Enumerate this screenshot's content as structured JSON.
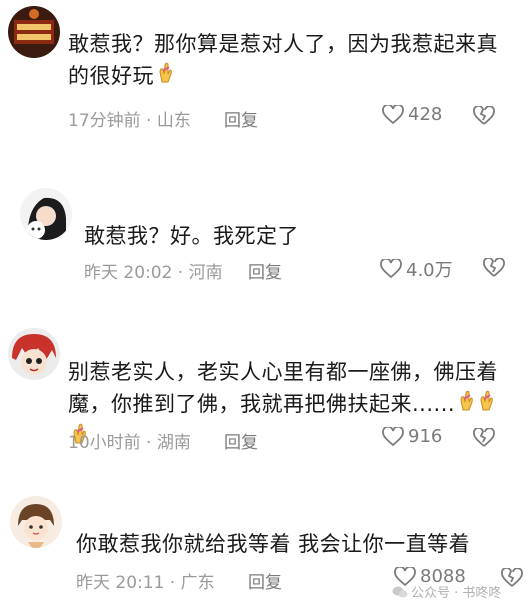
{
  "comments": [
    {
      "avatar": "avatar-sign-red",
      "text": "敢惹我？那你算是惹对人了，因为我惹起来真的很好玩",
      "emoji": "crossed-fingers-icon",
      "time": "17分钟前",
      "location": "山东",
      "reply_label": "回复",
      "likes": "428"
    },
    {
      "avatar": "avatar-girl-cat",
      "text": "敢惹我？好。我死定了",
      "emoji": "",
      "time": "昨天 20:02",
      "location": "河南",
      "reply_label": "回复",
      "likes": "4.0万"
    },
    {
      "avatar": "avatar-anime-redhair",
      "text": "别惹老实人，老实人心里有都一座佛，佛压着魔，你推到了佛，我就再把佛扶起来......",
      "emoji": "crossed-fingers-icon x3",
      "time": "10小时前",
      "location": "湖南",
      "reply_label": "回复",
      "likes": "916"
    },
    {
      "avatar": "avatar-child-cartoon",
      "text": "你敢惹我你就给我等着 我会让你一直等着",
      "emoji": "",
      "time": "昨天 20:11",
      "location": "广东",
      "reply_label": "回复",
      "likes": "8088"
    }
  ],
  "watermark": {
    "text": "公众号 · 书咚咚"
  },
  "colors": {
    "text": "#1a1a1a",
    "meta": "#9a9a9a",
    "reply": "#7a7a7a"
  }
}
